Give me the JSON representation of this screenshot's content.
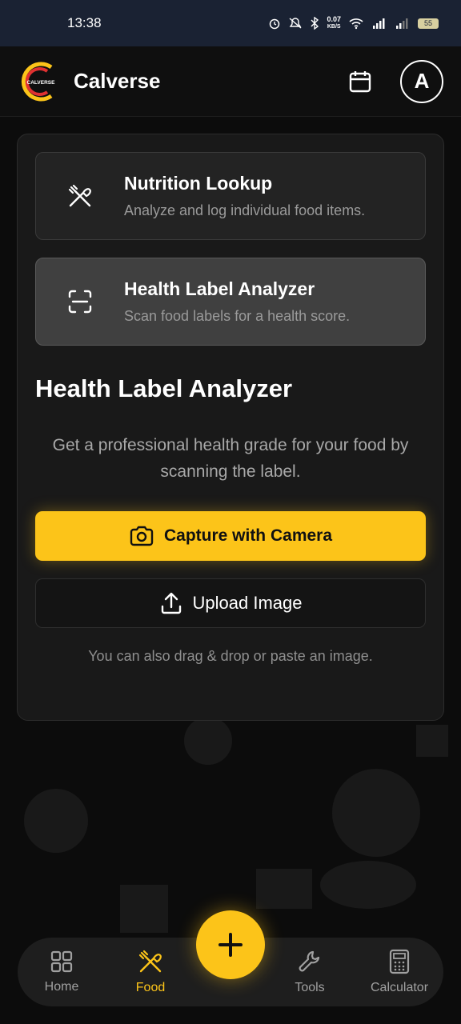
{
  "status_bar": {
    "time": "13:38",
    "net_speed_value": "0.07",
    "net_speed_unit": "KB/S",
    "battery": "55"
  },
  "header": {
    "logo_text": "CALVERSE",
    "brand": "Calverse",
    "avatar_initial": "A",
    "icons": [
      "calendar-icon"
    ]
  },
  "modes": [
    {
      "title": "Nutrition Lookup",
      "description": "Analyze and log individual food items.",
      "icon": "utensils-crossed-icon",
      "active": false
    },
    {
      "title": "Health Label Analyzer",
      "description": "Scan food labels for a health score.",
      "icon": "scan-icon",
      "active": true
    }
  ],
  "analyzer": {
    "title": "Health Label Analyzer",
    "description": "Get a professional health grade for your food by scanning the label.",
    "capture_label": "Capture with Camera",
    "upload_label": "Upload Image",
    "hint": "You can also drag & drop or paste an image."
  },
  "nav": {
    "items": [
      {
        "label": "Home",
        "icon": "grid-icon",
        "active": false
      },
      {
        "label": "Food",
        "icon": "utensils-crossed-icon",
        "active": true
      },
      {
        "label": "Tools",
        "icon": "wrench-icon",
        "active": false
      },
      {
        "label": "Calculator",
        "icon": "calculator-icon",
        "active": false
      }
    ],
    "fab_icon": "plus-icon"
  },
  "colors": {
    "accent": "#fcc419",
    "background": "#0c0c0c",
    "card": "#191919",
    "status_bar": "#1a2233"
  }
}
